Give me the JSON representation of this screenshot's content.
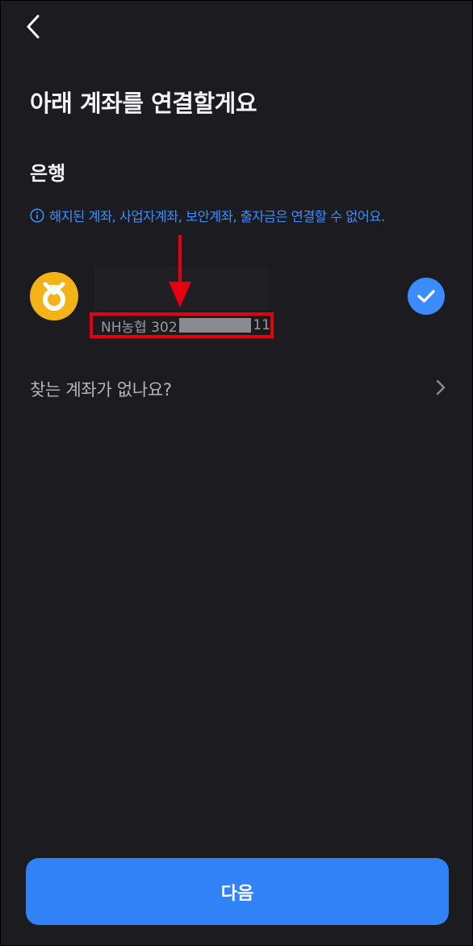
{
  "header": {
    "back_icon": "chevron-left-icon"
  },
  "title": "아래 계좌를 연결할게요",
  "section": {
    "title": "은행",
    "notice": "해지된 계좌, 사업자계좌, 보안계좌, 출자금은 연결할 수 없어요.",
    "notice_icon": "info-icon"
  },
  "account": {
    "bank_logo_icon": "nh-bank-logo-icon",
    "number_prefix": "NH농협 302",
    "number_suffix": "11",
    "selected": true,
    "check_icon": "check-icon"
  },
  "missing_account": {
    "label": "찾는 계좌가 없나요?",
    "chevron_icon": "chevron-right-icon"
  },
  "footer": {
    "next_label": "다음"
  },
  "colors": {
    "background": "#1b1b20",
    "accent": "#3182f6",
    "notice": "#3b8cff",
    "bank_logo": "#f2b318",
    "highlight_border": "#e6000f"
  }
}
